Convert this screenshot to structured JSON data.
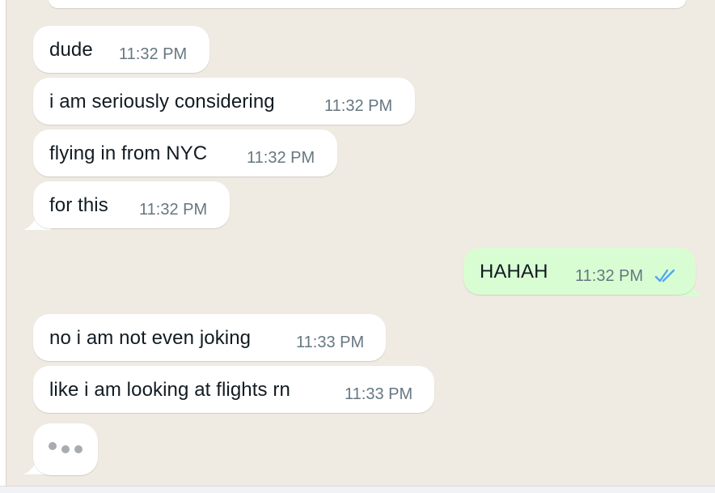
{
  "conversation": {
    "incoming_group_1": [
      {
        "text": "dude",
        "time": "11:32 PM"
      },
      {
        "text": "i am seriously considering",
        "time": "11:32 PM"
      },
      {
        "text": "flying in from NYC",
        "time": "11:32 PM"
      },
      {
        "text": "for this",
        "time": "11:32 PM"
      }
    ],
    "outgoing": {
      "text": "HAHAH",
      "time": "11:32 PM",
      "status_icon": "double-check-read-icon"
    },
    "incoming_group_2": [
      {
        "text": "no i am not even joking",
        "time": "11:33 PM"
      },
      {
        "text": "like i am looking at flights rn",
        "time": "11:33 PM"
      }
    ],
    "typing_indicator": {
      "icon": "typing-dots-icon"
    }
  },
  "colors": {
    "chat_background": "#efeae2",
    "incoming_bubble": "#ffffff",
    "outgoing_bubble": "#d9fdd3",
    "timestamp": "#667781",
    "read_ticks": "#53bdeb"
  }
}
